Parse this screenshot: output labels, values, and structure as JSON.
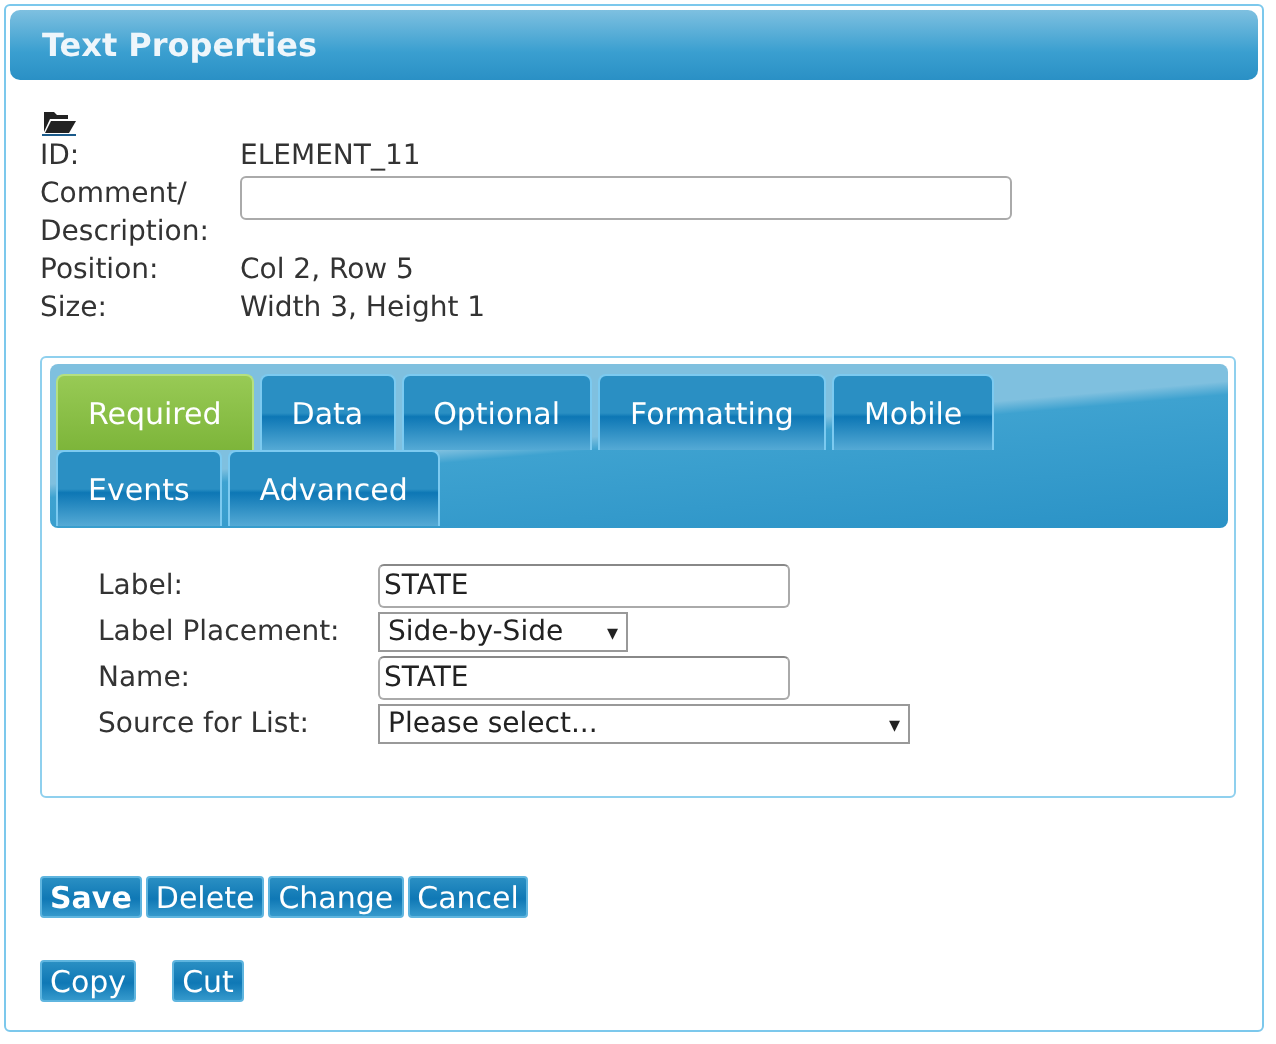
{
  "window": {
    "title": "Text Properties"
  },
  "info": [
    {
      "label": "ID:",
      "value": "ELEMENT_11",
      "kind": "text"
    },
    {
      "label": "Comment/ Description:",
      "kind": "input"
    },
    {
      "label": "Position:",
      "value": "Col 2, Row 5",
      "kind": "text"
    },
    {
      "label": "Size:",
      "value": "Width 3, Height 1",
      "kind": "text"
    }
  ],
  "tabs": [
    [
      {
        "label": "Required",
        "selected": true
      },
      {
        "label": "Data",
        "selected": false
      },
      {
        "label": "Optional",
        "selected": false
      },
      {
        "label": "Formatting",
        "selected": false
      },
      {
        "label": "Mobile",
        "selected": false
      }
    ],
    [
      {
        "label": "Events",
        "selected": false
      },
      {
        "label": "Advanced",
        "selected": false
      }
    ]
  ],
  "fields": [
    {
      "label": "Label:",
      "kind": "text",
      "value": "STATE"
    },
    {
      "label": "Label Placement:",
      "kind": "select",
      "value": "Side-by-Side",
      "caret": "▾"
    },
    {
      "label": "Name:",
      "kind": "text",
      "value": "STATE"
    },
    {
      "label": "Source for List:",
      "kind": "wideselect",
      "value": "Please select...",
      "caret": "▾"
    }
  ],
  "buttons": [
    [
      {
        "label": "Save",
        "kind": "primary"
      },
      {
        "label": "Delete",
        "kind": "normal"
      },
      {
        "label": "Change",
        "kind": "normal"
      },
      {
        "label": "Cancel",
        "kind": "normal"
      }
    ],
    [
      {
        "label": "Copy",
        "kind": "normal"
      },
      {
        "label": "Cut",
        "kind": "normal"
      }
    ]
  ]
}
